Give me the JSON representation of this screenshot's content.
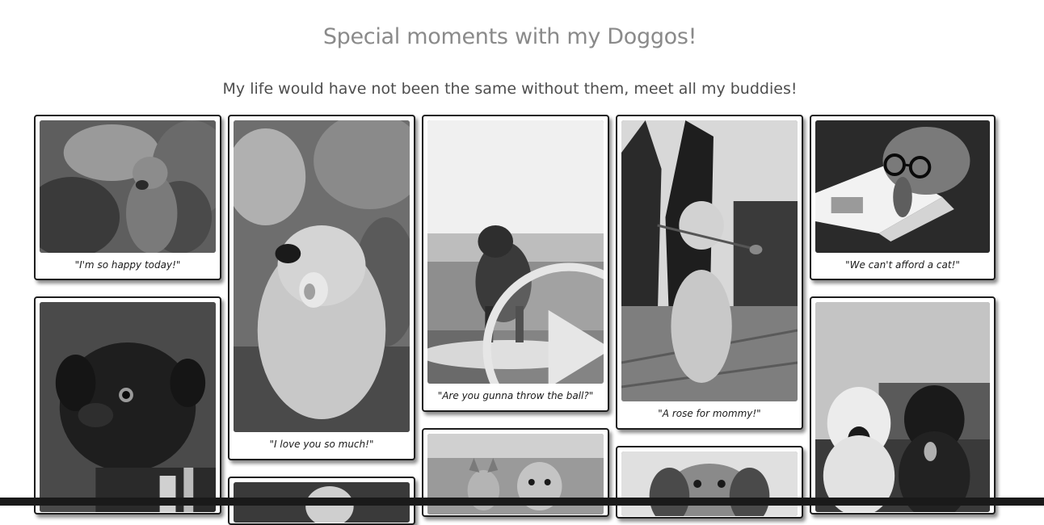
{
  "header": {
    "title": "Special moments with my Doggos!",
    "subtitle": "My life would have not been the same without them, meet all my buddies!"
  },
  "gallery": {
    "cards": [
      {
        "caption": "\"I'm so happy today!\"",
        "photo": "dog in meadow",
        "media": "image"
      },
      {
        "caption": "\"I love you so much!\"",
        "photo": "golden retriever with flower",
        "media": "image"
      },
      {
        "caption": "\"Are you gunna throw the ball?\"",
        "photo": "dog running on beach",
        "media": "video"
      },
      {
        "caption": "\"A rose for mommy!\"",
        "photo": "puppy holding a rose",
        "media": "image"
      },
      {
        "caption": "\"We can't afford a cat!\"",
        "photo": "dog with glasses reading magazine",
        "media": "image"
      },
      {
        "caption": "",
        "photo": "black pug",
        "media": "image"
      },
      {
        "caption": "",
        "photo": "white and black dogs together",
        "media": "image"
      },
      {
        "caption": "",
        "photo": "dog close-up",
        "media": "image"
      },
      {
        "caption": "",
        "photo": "corgi and small dog",
        "media": "image"
      },
      {
        "caption": "",
        "photo": "spaniel looking up",
        "media": "image"
      }
    ]
  },
  "icons": {
    "play": "play-icon"
  },
  "colors": {
    "background": "#ffffff",
    "title": "#8a8a8a",
    "subtitle": "#4e4e4e",
    "card_border": "#1e1e1e",
    "bottom_bar": "#1a1a1a"
  }
}
